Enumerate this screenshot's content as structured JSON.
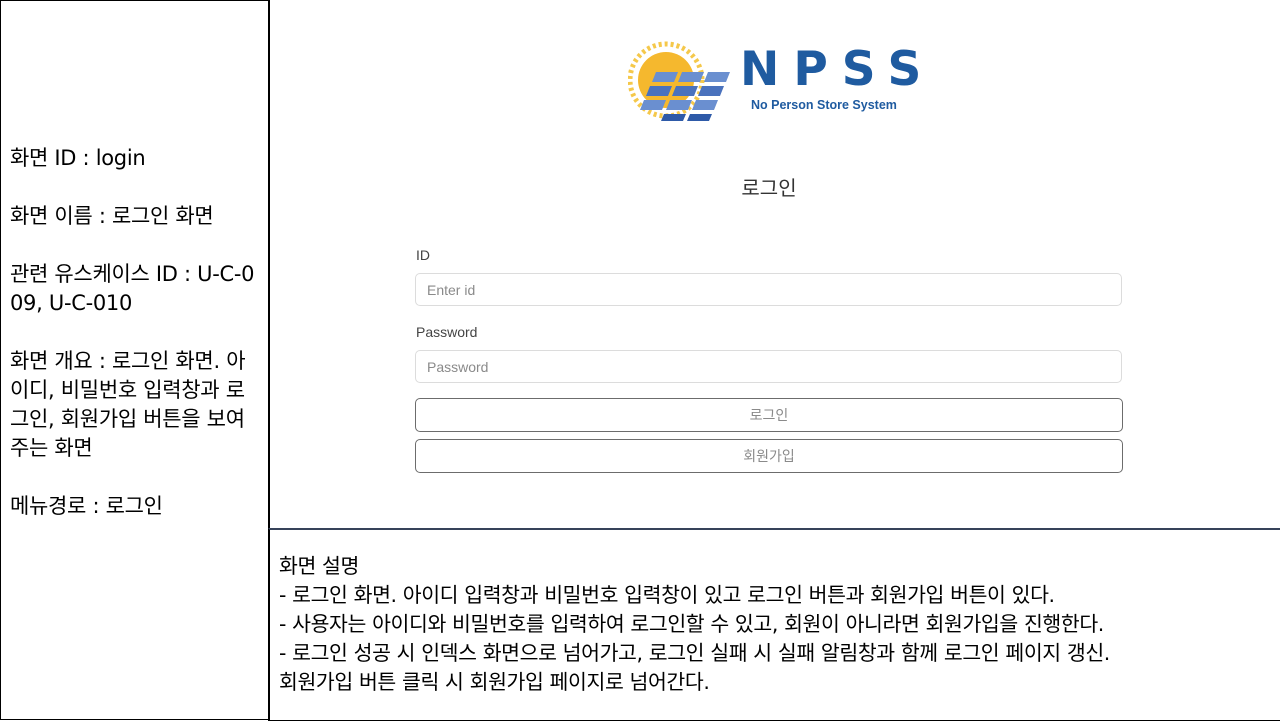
{
  "spec": {
    "screen_id": "화면 ID : login",
    "screen_name": "화면 이름 : 로그인 화면",
    "usecase": "관련 유스케이스 ID : U-C-009, U-C-010",
    "overview": "화면 개요 : 로그인 화면. 아이디, 비밀번호 입력창과 로그인, 회원가입 버튼을 보여주는 화면",
    "menu_path": "메뉴경로 : 로그인"
  },
  "logo": {
    "title": "NPSS",
    "subtitle": "No Person Store System",
    "colors": {
      "brand": "#1f5ba0",
      "sun": "#f5b82e",
      "panel": "#6a8fd0"
    }
  },
  "login": {
    "title": "로그인",
    "id_label": "ID",
    "id_placeholder": "Enter id",
    "password_label": "Password",
    "password_placeholder": "Password",
    "login_button": "로그인",
    "signup_button": "회원가입"
  },
  "description": {
    "heading": "화면 설명",
    "lines": [
      "- 로그인 화면. 아이디 입력창과 비밀번호 입력창이 있고 로그인 버튼과 회원가입 버튼이 있다.",
      "- 사용자는 아이디와 비밀번호를 입력하여 로그인할 수 있고, 회원이 아니라면 회원가입을 진행한다.",
      "- 로그인 성공 시 인덱스 화면으로 넘어가고, 로그인 실패 시 실패 알림창과 함께 로그인 페이지 갱신.",
      "회원가입 버튼 클릭 시 회원가입 페이지로 넘어간다."
    ]
  }
}
